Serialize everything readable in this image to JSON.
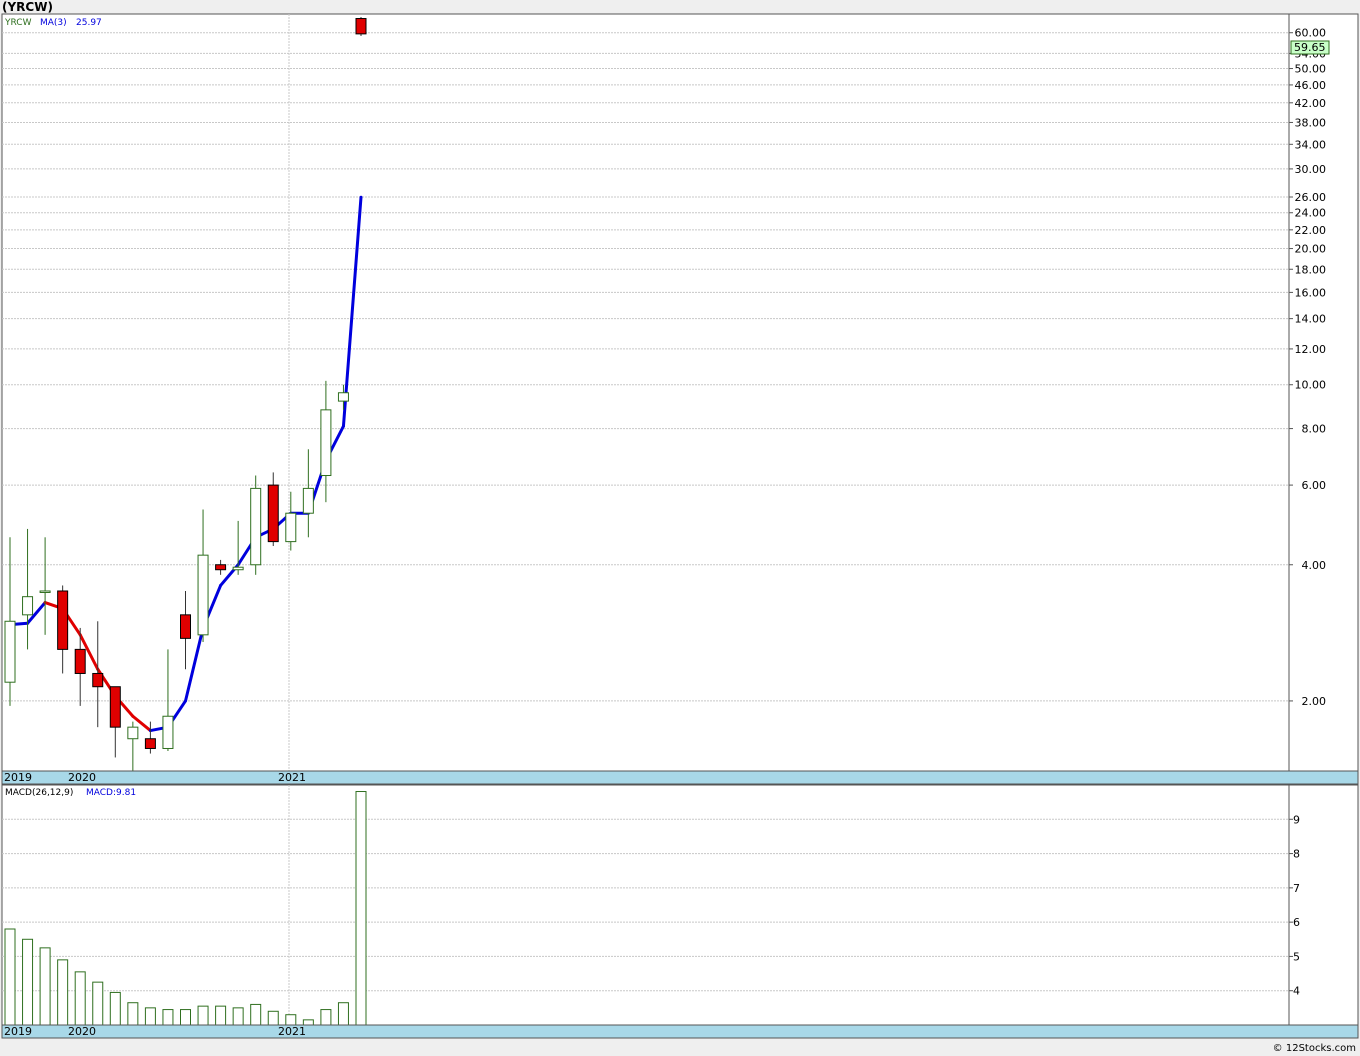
{
  "title": "(YRCW)",
  "credit": "© 12Stocks.com",
  "colors": {
    "up": "#2f6f1f",
    "down_fill": "#e00000",
    "ma_up": "#0000dd",
    "ma_down": "#e00000",
    "date_band": "#a8d8e8",
    "last_badge": "#c8ffc8"
  },
  "chart_data": [
    {
      "type": "candlestick",
      "ticker": "YRCW",
      "indicator_label": "MA(3)",
      "indicator_value": "25.97",
      "last_price": "59.65",
      "scale": "log",
      "ylim": [
        1.4,
        66
      ],
      "y_tick_labels": [
        "2.00",
        "4.00",
        "6.00",
        "8.00",
        "10.00",
        "12.00",
        "14.00",
        "16.00",
        "18.00",
        "20.00",
        "22.00",
        "24.00",
        "26.00",
        "30.00",
        "34.00",
        "38.00",
        "42.00",
        "46.00",
        "50.00",
        "54.00",
        "60.00"
      ],
      "x_labels": [
        "2019",
        "2020",
        "2021"
      ],
      "candles": [
        {
          "o": 2.2,
          "h": 4.6,
          "l": 1.95,
          "c": 3.0
        },
        {
          "o": 3.1,
          "h": 4.8,
          "l": 2.6,
          "c": 3.4
        },
        {
          "o": 3.5,
          "h": 4.6,
          "l": 2.8,
          "c": 3.5
        },
        {
          "o": 3.5,
          "h": 3.6,
          "l": 2.3,
          "c": 2.6
        },
        {
          "o": 2.6,
          "h": 2.9,
          "l": 1.95,
          "c": 2.3
        },
        {
          "o": 2.3,
          "h": 3.0,
          "l": 1.75,
          "c": 2.15
        },
        {
          "o": 2.15,
          "h": 2.15,
          "l": 1.5,
          "c": 1.75
        },
        {
          "o": 1.65,
          "h": 1.8,
          "l": 1.4,
          "c": 1.75
        },
        {
          "o": 1.65,
          "h": 1.8,
          "l": 1.53,
          "c": 1.57
        },
        {
          "o": 1.57,
          "h": 2.6,
          "l": 1.55,
          "c": 1.85
        },
        {
          "o": 3.1,
          "h": 3.5,
          "l": 2.35,
          "c": 2.75
        },
        {
          "o": 2.8,
          "h": 5.3,
          "l": 2.7,
          "c": 4.2
        },
        {
          "o": 4.0,
          "h": 4.1,
          "l": 3.8,
          "c": 3.9
        },
        {
          "o": 3.9,
          "h": 5.0,
          "l": 3.8,
          "c": 3.95
        },
        {
          "o": 4.0,
          "h": 6.3,
          "l": 3.8,
          "c": 5.9
        },
        {
          "o": 6.0,
          "h": 6.4,
          "l": 4.4,
          "c": 4.5
        },
        {
          "o": 4.5,
          "h": 5.8,
          "l": 4.3,
          "c": 5.2
        },
        {
          "o": 5.2,
          "h": 7.2,
          "l": 4.6,
          "c": 5.9
        },
        {
          "o": 6.3,
          "h": 10.2,
          "l": 5.5,
          "c": 8.8
        },
        {
          "o": 9.2,
          "h": 10.0,
          "l": 8.8,
          "c": 9.6
        },
        {
          "o": 64.5,
          "h": 65.0,
          "l": 59.0,
          "c": 59.65
        }
      ],
      "ma": [
        2.95,
        2.97,
        3.3,
        3.2,
        2.8,
        2.35,
        2.05,
        1.85,
        1.72,
        1.75,
        2.0,
        2.9,
        3.6,
        4.0,
        4.6,
        4.8,
        5.2,
        5.2,
        6.8,
        8.1,
        25.97
      ]
    },
    {
      "type": "bar",
      "indicator_label": "MACD(26,12,9)",
      "indicator_value": "MACD:9.81",
      "y_tick_labels": [
        "4",
        "5",
        "6",
        "7",
        "8",
        "9"
      ],
      "ylim": [
        3.0,
        10.0
      ],
      "x_labels": [
        "2019",
        "2020",
        "2021"
      ],
      "values": [
        5.8,
        5.5,
        5.25,
        4.9,
        4.55,
        4.25,
        3.95,
        3.65,
        3.5,
        3.45,
        3.45,
        3.55,
        3.55,
        3.5,
        3.6,
        3.4,
        3.3,
        3.15,
        3.45,
        3.65,
        9.81
      ]
    }
  ]
}
